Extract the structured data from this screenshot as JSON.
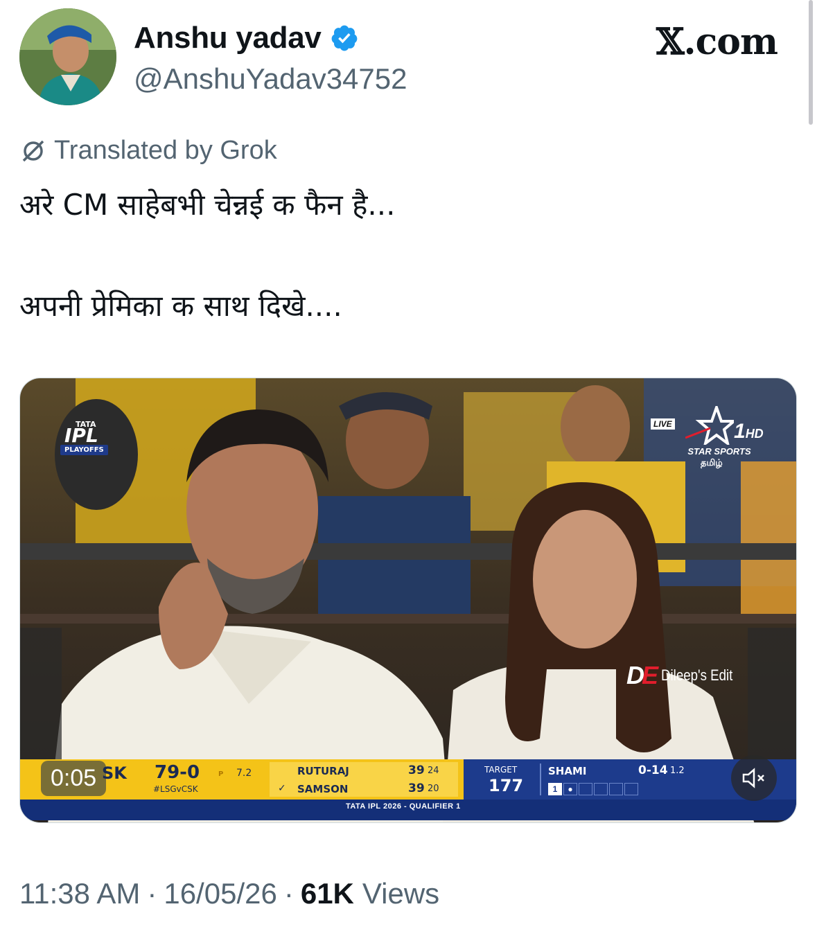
{
  "author": {
    "display_name": "Anshu yadav",
    "handle": "@AnshuYadav34752",
    "verified": true
  },
  "brand": {
    "label": "𝕏.com"
  },
  "translation": {
    "label": "Translated by Grok"
  },
  "tweet": {
    "line1": "अरे CM साहेबभी चेन्नई क फैन है...",
    "line2": "अपनी प्रेमिका क साथ दिखे...."
  },
  "media": {
    "ipl": {
      "tata": "TATA",
      "name": "IPL",
      "playoffs": "PLAYOFFS"
    },
    "broadcaster": {
      "live": "LIVE",
      "channel": "1",
      "hd": "HD",
      "name": "STAR SPORTS",
      "language": "தமிழ்"
    },
    "watermark": {
      "logo_d": "D",
      "logo_e": "E",
      "text": "Dileep's Edit"
    },
    "timer": "0:05",
    "scorebar": {
      "team": "SK",
      "score": "79-0",
      "powerplay": "P",
      "overs": "7.2",
      "hashtag": "#LSGvCSK",
      "batter1": {
        "name": "RUTURAJ",
        "runs": "39",
        "balls": "24"
      },
      "batter2": {
        "name": "SAMSON",
        "runs": "39",
        "balls": "20"
      },
      "target_label": "TARGET",
      "target": "177",
      "bowler": {
        "name": "SHAMI",
        "figures": "0-14",
        "overs": "1.2",
        "ball": "1"
      },
      "caption": "TATA IPL 2026 - QUALIFIER 1"
    },
    "mute_icon": "speaker-muted-icon"
  },
  "meta": {
    "time": "11:38 AM",
    "date": "16/05/26",
    "views_count": "61K",
    "views_label": "Views",
    "separator": "·"
  },
  "colors": {
    "verified_blue": "#1d9bf0",
    "secondary_text": "#536471",
    "scorebar_yellow": "#f4c318",
    "scorebar_blue": "#1d3b8c"
  }
}
